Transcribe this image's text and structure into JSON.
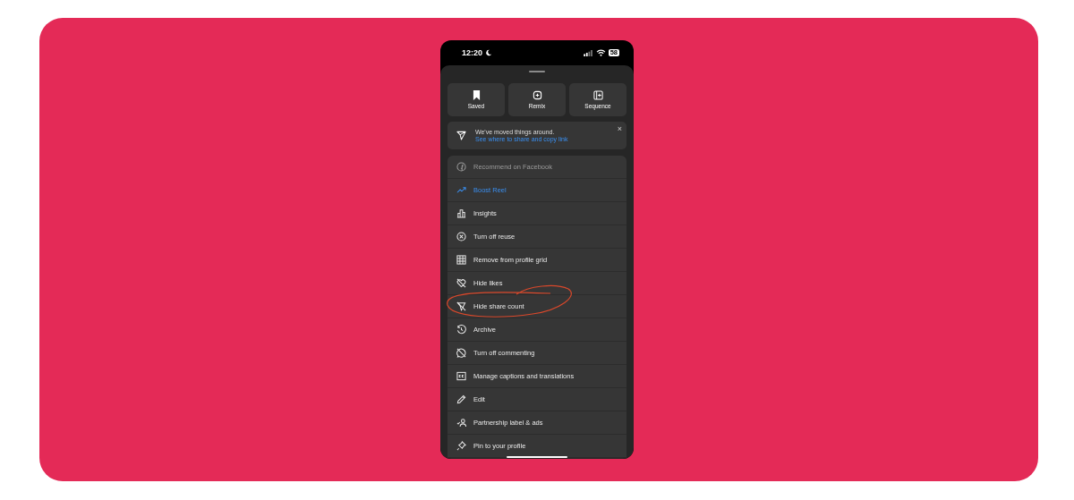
{
  "status_bar": {
    "time": "12:20",
    "battery": "58"
  },
  "tiles": [
    {
      "label": "Saved"
    },
    {
      "label": "Remix"
    },
    {
      "label": "Sequence"
    }
  ],
  "notice": {
    "title": "We've moved things around.",
    "link": "See where to share and copy link",
    "close": "×"
  },
  "menu": [
    {
      "label": "Recommend on Facebook",
      "kind": "muted"
    },
    {
      "label": "Boost Reel",
      "kind": "accent"
    },
    {
      "label": "Insights",
      "kind": "normal"
    },
    {
      "label": "Turn off reuse",
      "kind": "normal"
    },
    {
      "label": "Remove from profile grid",
      "kind": "normal"
    },
    {
      "label": "Hide likes",
      "kind": "normal"
    },
    {
      "label": "Hide share count",
      "kind": "normal"
    },
    {
      "label": "Archive",
      "kind": "normal"
    },
    {
      "label": "Turn off commenting",
      "kind": "normal"
    },
    {
      "label": "Manage captions and translations",
      "kind": "normal"
    },
    {
      "label": "Edit",
      "kind": "normal"
    },
    {
      "label": "Partnership label & ads",
      "kind": "normal"
    },
    {
      "label": "Pin to your profile",
      "kind": "normal"
    }
  ]
}
